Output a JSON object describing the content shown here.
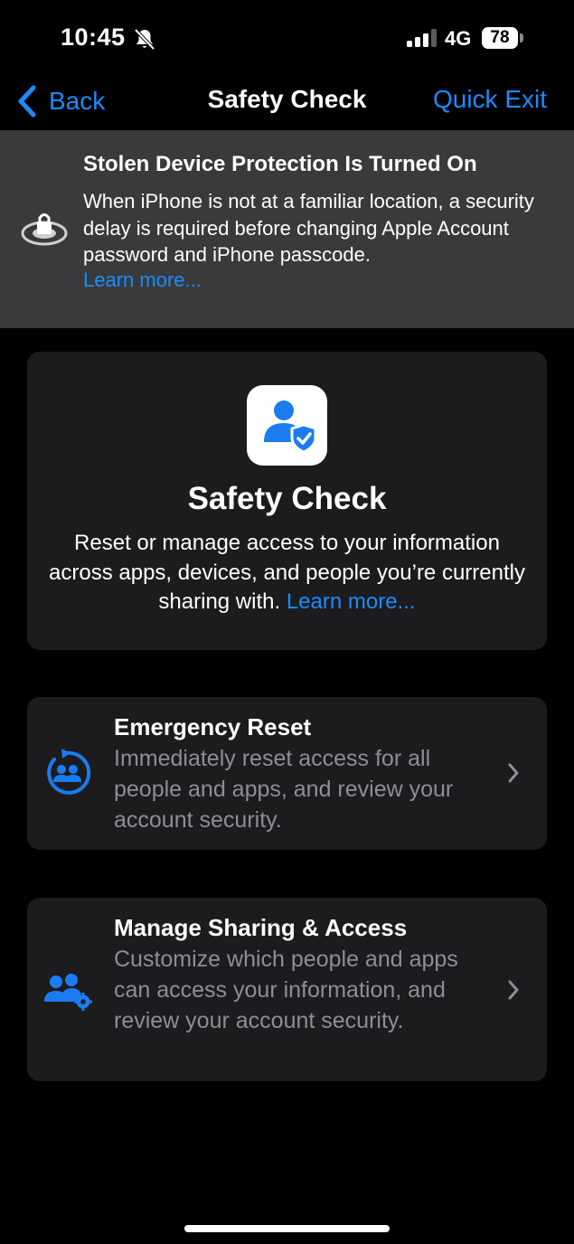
{
  "status_bar": {
    "time": "10:45",
    "network": "4G",
    "battery": "78"
  },
  "nav": {
    "back_label": "Back",
    "title": "Safety Check",
    "quick_exit_label": "Quick Exit"
  },
  "banner": {
    "title": "Stolen Device Protection Is Turned On",
    "body": "When iPhone is not at a familiar location, a security delay is required before changing Apple Account password and iPhone passcode.",
    "link": "Learn more..."
  },
  "hero": {
    "title": "Safety Check",
    "description": "Reset or manage access to your information across apps, devices, and people you’re currently sharing with.",
    "link": "Learn more..."
  },
  "options": [
    {
      "title": "Emergency Reset",
      "description": "Immediately reset access for all people and apps, and review your account security.",
      "icon": "emergency-reset-icon"
    },
    {
      "title": "Manage Sharing & Access",
      "description": "Customize which people and apps can access your information, and review your account security.",
      "icon": "manage-sharing-icon"
    }
  ],
  "colors": {
    "accent": "#1a8cff",
    "background": "#000000",
    "card": "#1c1c1e",
    "banner": "#3a3a3c",
    "secondary_text": "#8e8e93"
  }
}
